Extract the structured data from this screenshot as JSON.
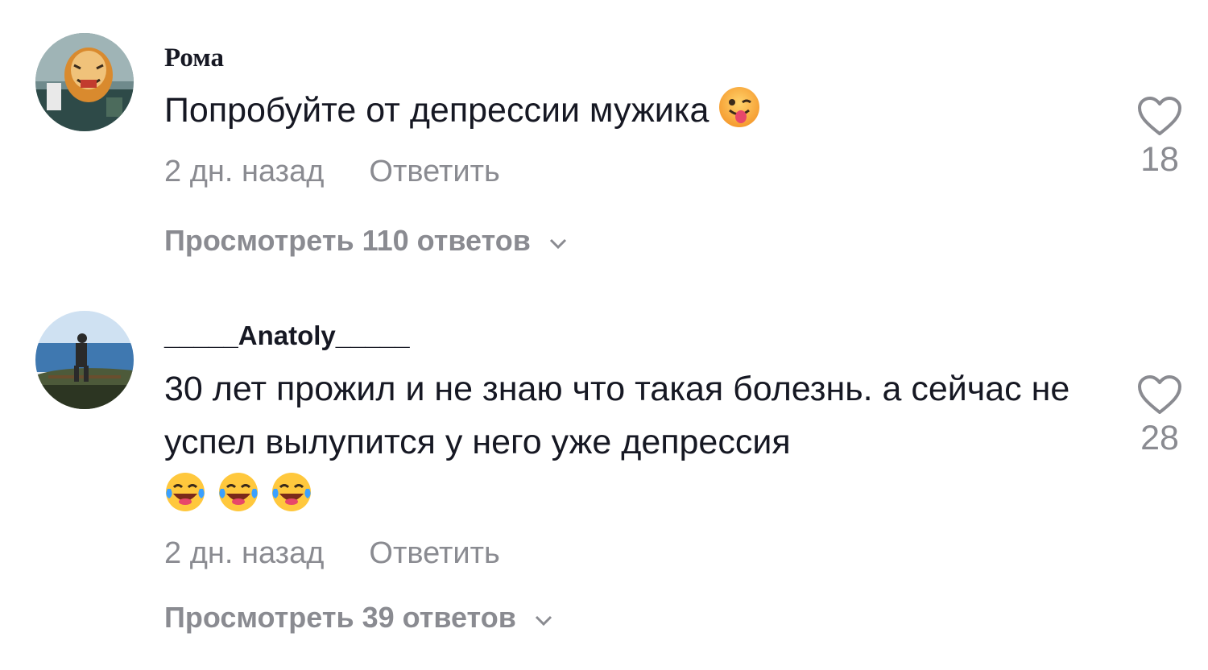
{
  "comments": [
    {
      "username": "Рома",
      "text": "Попробуйте от депрессии мужика",
      "emoji": "winking-tongue-face-emoji",
      "time": "2 дн. назад",
      "reply_label": "Ответить",
      "likes": "18",
      "view_replies": "Просмотреть 110 ответов"
    },
    {
      "username": "_____Anatoly_____",
      "text": "30 лет прожил и не знаю что такая болезнь. а сейчас не успел вылупится у него уже депрессия",
      "emoji": "tears-of-joy-emoji",
      "time": "2 дн. назад",
      "reply_label": "Ответить",
      "likes": "28",
      "view_replies": "Просмотреть 39 ответов"
    }
  ],
  "icons": {
    "like": "heart-outline-icon",
    "expand": "chevron-down-icon"
  },
  "colors": {
    "primary_text": "#161823",
    "secondary_text": "#8a8b91"
  }
}
